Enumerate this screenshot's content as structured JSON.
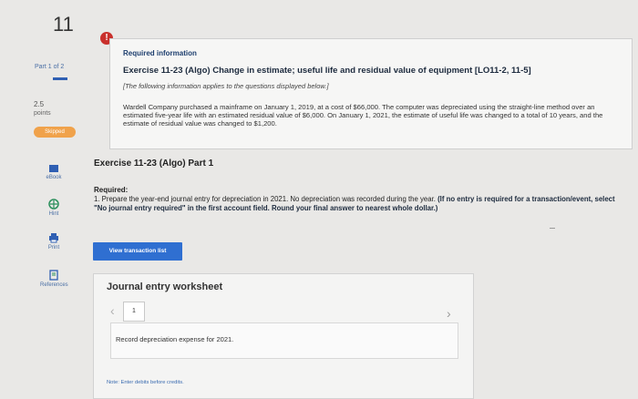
{
  "question_number": "11",
  "sidebar": {
    "part": "Part 1 of 2",
    "points_value": "2.5",
    "points_label": "points",
    "status_badge": "Skipped",
    "tools": [
      "eBook",
      "Hint",
      "Print",
      "References"
    ]
  },
  "alert_icon": "!",
  "info": {
    "title": "Required information",
    "exercise_title": "Exercise 11-23 (Algo) Change in estimate; useful life and residual value of equipment [LO11-2, 11-5]",
    "note": "[The following information applies to the questions displayed below.]",
    "description": "Wardell Company purchased a mainframe on January 1, 2019, at a cost of $66,000. The computer was depreciated using the straight-line method over an estimated five-year life with an estimated residual value of $6,000. On January 1, 2021, the estimate of useful life was changed to a total of 10 years, and the estimate of residual value was changed to $1,200."
  },
  "part_heading": "Exercise 11-23 (Algo) Part 1",
  "required": {
    "label": "Required:",
    "text_plain": "1. Prepare the year-end journal entry for depreciation in 2021. No depreciation was recorded during the year. ",
    "text_bold": "(If no entry is required for a transaction/event, select \"No journal entry required\" in the first account field. Round your final answer to nearest whole dollar.)"
  },
  "view_transaction_button": "View transaction list",
  "journal": {
    "title": "Journal entry worksheet",
    "page": "1",
    "task": "Record depreciation expense for 2021.",
    "note": "Note: Enter debits before credits."
  },
  "colors": {
    "accent_blue": "#2f6fd1",
    "alert_red": "#c9302c",
    "skipped_orange": "#f0a24b"
  }
}
